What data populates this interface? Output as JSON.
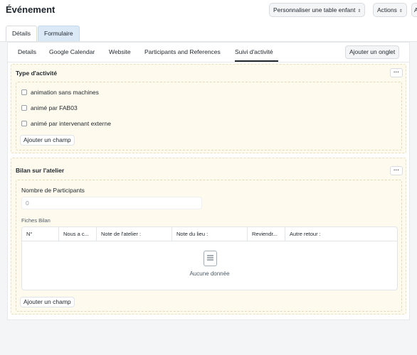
{
  "header": {
    "title": "Événement",
    "customize_label": "Personnaliser une table enfant",
    "actions_label": "Actions",
    "overflow_letter": "A"
  },
  "main_tabs": [
    "Détails",
    "Formulaire"
  ],
  "sub_tabs": [
    "Details",
    "Google Calendar",
    "Website",
    "Participants and References",
    "Suivi d'activité"
  ],
  "add_tab_label": "Ajouter un onglet",
  "sections": [
    {
      "title": "Type d'activité",
      "menu": "···",
      "checkboxes": [
        "animation sans machines",
        "animé par FAB03",
        "animé par intervenant externe"
      ],
      "add_field": "Ajouter un champ"
    },
    {
      "title": "Bilan sur l'atelier",
      "menu": "···",
      "number_label": "Nombre de Participants",
      "number_value": "0",
      "table_label": "Fiches Bilan",
      "columns": [
        "N°",
        "Nous a c...",
        "Note de l'atelier :",
        "Note du lieu :",
        "Reviendr...",
        "Autre retour :"
      ],
      "empty_text": "Aucune donnée",
      "add_field": "Ajouter un champ"
    }
  ],
  "colors": {
    "section_bg": "#fefaed",
    "active_tab_bg": "#dbe9f6"
  }
}
